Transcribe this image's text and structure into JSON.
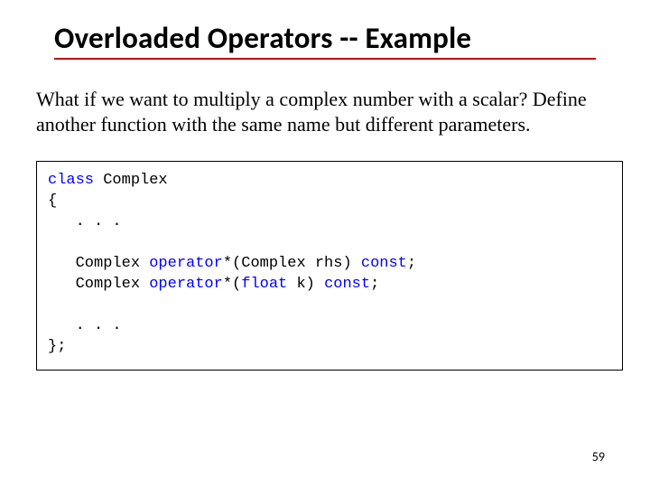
{
  "title": "Overloaded Operators -- Example",
  "body": "What if we want to multiply a complex number with a scalar? Define another function with the same name but different parameters.",
  "code": {
    "l1a": "class",
    "l1b": " Complex",
    "l2": "{",
    "l3": "   . . .",
    "blank1": "",
    "l4a": "   Complex ",
    "l4b": "operator",
    "l4c": "*(Complex rhs) ",
    "l4d": "const",
    "l4e": ";",
    "l5a": "   Complex ",
    "l5b": "operator",
    "l5c": "*(",
    "l5d": "float",
    "l5e": " k) ",
    "l5f": "const",
    "l5g": ";",
    "blank2": "",
    "l6": "   . . .",
    "l7": "};"
  },
  "page_number": "59"
}
